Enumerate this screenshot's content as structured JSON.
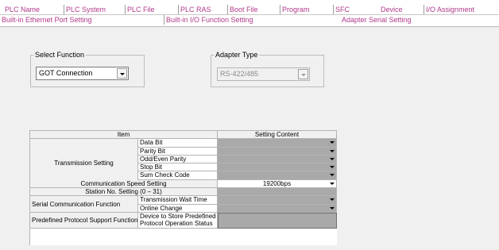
{
  "tabs_row1": [
    "PLC Name",
    "PLC System",
    "PLC File",
    "PLC RAS",
    "Boot File",
    "Program",
    "SFC",
    "Device",
    "I/O Assignment"
  ],
  "tabs_row2": [
    "Built-in Ethernet Port Setting",
    "Built-in I/O Function Setting",
    "Adapter Serial Setting"
  ],
  "select_function": {
    "legend": "Select Function",
    "value": "GOT Connection"
  },
  "adapter_type": {
    "legend": "Adapter Type",
    "value": "RS-422/485"
  },
  "table": {
    "header_item": "Item",
    "header_content": "Setting Content",
    "transmission_setting": "Transmission Setting",
    "data_bit": "Data Bit",
    "parity_bit": "Parity Bit",
    "odd_even_parity": "Odd/Even Parity",
    "stop_bit": "Stop Bit",
    "sum_check_code": "Sum Check Code",
    "comm_speed": "Communication Speed Setting",
    "comm_speed_value": "19200bps",
    "station_no": "Station No. Setting (0 – 31)",
    "serial_comm": "Serial Communication Function",
    "transmission_wait": "Transmission Wait Time",
    "online_change": "Online Change",
    "predefined_protocol": "Predefined Protocol Support Function",
    "device_store_line1": "Device to Store Predefined",
    "device_store_line2": "Protocol Operation Status"
  }
}
